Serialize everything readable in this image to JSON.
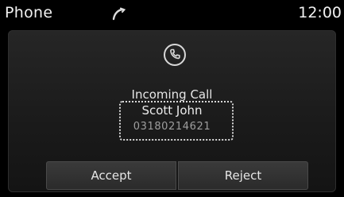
{
  "status_bar": {
    "app_title": "Phone",
    "clock": "12:00",
    "signal_icon": "handset-outline-icon"
  },
  "call": {
    "icon": "phone-circle-icon",
    "title": "Incoming Call",
    "caller_name": "Scott John",
    "caller_number": "03180214621"
  },
  "actions": {
    "accept_label": "Accept",
    "reject_label": "Reject"
  },
  "colors": {
    "background": "#000000",
    "panel": "#1f1f1f",
    "text": "#e8e8e8",
    "muted_text": "#9e9e9e"
  }
}
